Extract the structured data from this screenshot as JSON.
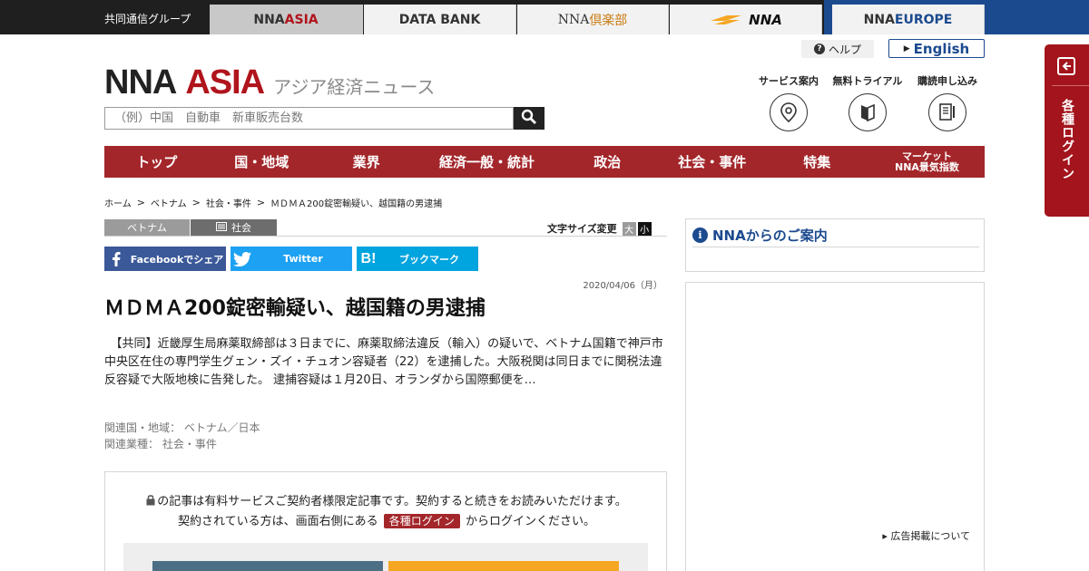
{
  "topbar": {
    "group_label": "共同通信グループ",
    "tabs": [
      {
        "part1": "NNA ",
        "part2": "ASIA"
      },
      {
        "label": "DATA BANK"
      },
      {
        "part1": "NNA",
        "part2": "倶楽部"
      },
      {
        "label": "NNA"
      },
      {
        "part1": "NNA ",
        "part2": "EUROPE"
      }
    ]
  },
  "header": {
    "logo_nna": "NNA",
    "logo_asia": "ASIA",
    "logo_sub": "アジア経済ニュース",
    "search_placeholder": "（例）中国　自動車　新車販売台数",
    "help_label": "ヘルプ",
    "english_label": "English",
    "services": [
      {
        "label": "サービス案内",
        "icon": "map-pin-icon"
      },
      {
        "label": "無料トライアル",
        "icon": "book-icon"
      },
      {
        "label": "購読申し込み",
        "icon": "document-pen-icon"
      }
    ]
  },
  "nav": {
    "items": [
      "トップ",
      "国・地域",
      "業界",
      "経済一般・統計",
      "政治",
      "社会・事件",
      "特集"
    ],
    "last_line1": "マーケット",
    "last_line2": "NNA景気指数"
  },
  "breadcrumb": [
    "ホーム",
    "ベトナム",
    "社会・事件",
    "ＭＤＭＡ200錠密輸疑い、越国籍の男逮捕"
  ],
  "article": {
    "tag_country": "ベトナム",
    "tag_category": "社会",
    "fontsize_label": "文字サイズ変更",
    "fontsize_big": "大",
    "fontsize_small": "小",
    "share_facebook": "Facebookでシェア",
    "share_twitter": "Twitter",
    "share_hatena": "ブックマーク",
    "date": "2020/04/06（月）",
    "headline": "ＭＤＭＡ200錠密輸疑い、越国籍の男逮捕",
    "body": "　【共同】近畿厚生局麻薬取締部は３日までに、麻薬取締法違反（輸入）の疑いで、ベトナム国籍で神戸市中央区在住の専門学生グェン・ズイ・チュオン容疑者（22）を逮捕した。大阪税関は同日までに関税法違反容疑で大阪地検に告発した。 逮捕容疑は１月20日、オランダから国際郵便を…",
    "related_region": "関連国・地域：  ベトナム／日本",
    "related_industry": "関連業種：  社会・事件",
    "paywall_line1": "の記事は有料サービスご契約者様限定記事です。契約すると続きをお読みいただけます。",
    "paywall_line2a": "契約されている方は、画面右側にある",
    "paywall_login": "各種ログイン",
    "paywall_line2b": "からログインください。"
  },
  "sidebar": {
    "info_title": "NNAからのご案内",
    "ad_link": "▸ 広告掲載について",
    "login_label": "各種ログイン"
  },
  "colors": {
    "brand_red": "#a3262a",
    "brand_blue": "#1c4a8f",
    "facebook": "#3b5998",
    "twitter": "#1da1f2",
    "hatena": "#00a4de"
  }
}
